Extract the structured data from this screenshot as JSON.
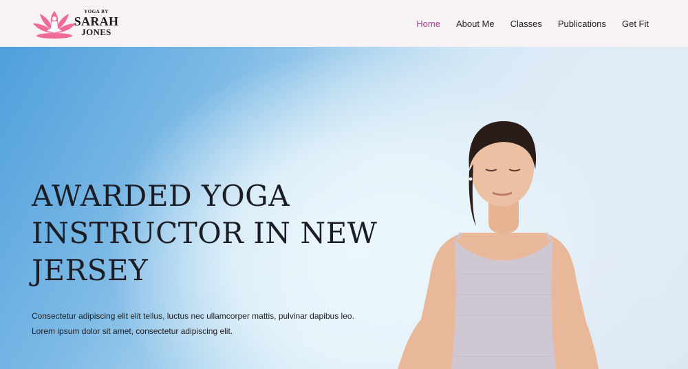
{
  "brand": {
    "small": "YOGA BY",
    "name_line1": "SARAH",
    "name_line2": "JONES",
    "accent": "#f06b9a"
  },
  "nav": {
    "items": [
      {
        "label": "Home",
        "active": true
      },
      {
        "label": "About Me",
        "active": false
      },
      {
        "label": "Classes",
        "active": false
      },
      {
        "label": "Publications",
        "active": false
      },
      {
        "label": "Get Fit",
        "active": false
      }
    ],
    "active_color": "#a5418f"
  },
  "hero": {
    "title": "AWARDED YOGA INSTRUCTOR IN NEW JERSEY",
    "text_line1": "Consectetur adipiscing elit elit tellus, luctus nec ullamcorper mattis, pulvinar dapibus leo.",
    "text_line2": "Lorem ipsum dolor sit amet, consectetur adipiscing elit."
  }
}
